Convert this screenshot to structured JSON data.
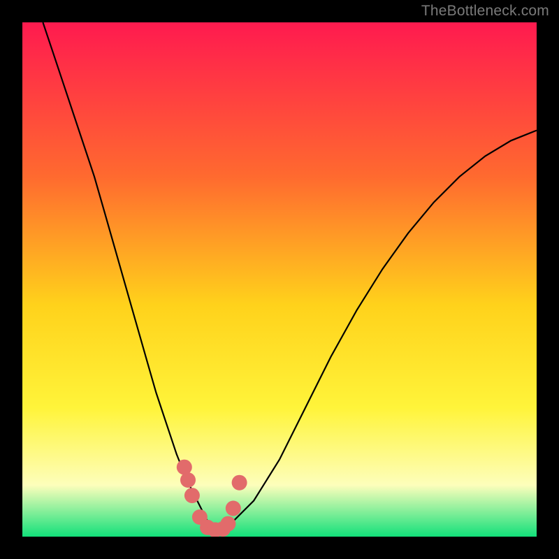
{
  "watermark": "TheBottleneck.com",
  "colors": {
    "frame": "#000000",
    "gradient_top": "#ff1a4f",
    "gradient_mid1": "#ff6a2f",
    "gradient_mid2": "#ffd21b",
    "gradient_mid3": "#fff43a",
    "gradient_low": "#fdfebb",
    "gradient_bottom": "#12e07a",
    "curve": "#000000",
    "markers": "#e26b6b"
  },
  "chart_data": {
    "type": "line",
    "title": "",
    "xlabel": "",
    "ylabel": "",
    "xlim": [
      0,
      100
    ],
    "ylim": [
      0,
      100
    ],
    "series": [
      {
        "name": "bottleneck-curve",
        "x": [
          4,
          6,
          8,
          10,
          12,
          14,
          16,
          18,
          20,
          22,
          24,
          26,
          28,
          30,
          32,
          34,
          36,
          38,
          40,
          45,
          50,
          55,
          60,
          65,
          70,
          75,
          80,
          85,
          90,
          95,
          100
        ],
        "y": [
          100,
          94,
          88,
          82,
          76,
          70,
          63,
          56,
          49,
          42,
          35,
          28,
          22,
          16,
          11,
          7,
          3,
          1,
          2,
          7,
          15,
          25,
          35,
          44,
          52,
          59,
          65,
          70,
          74,
          77,
          79
        ]
      }
    ],
    "markers": {
      "name": "highlight-points",
      "x": [
        31.5,
        32.2,
        33.0,
        34.5,
        36.0,
        37.5,
        39.0,
        40.0,
        41.0,
        42.2
      ],
      "y": [
        13.5,
        11.0,
        8.0,
        3.8,
        1.8,
        1.3,
        1.5,
        2.5,
        5.5,
        10.5
      ]
    }
  }
}
